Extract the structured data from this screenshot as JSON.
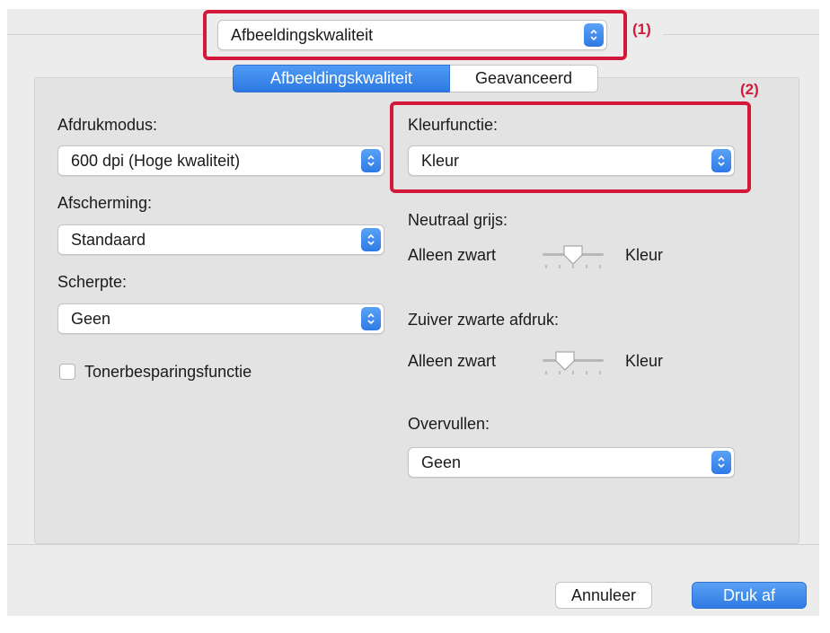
{
  "popup": {
    "value": "Afbeeldingskwaliteit",
    "icon": "chevron-updown-icon"
  },
  "tabs": [
    {
      "label": "Afbeeldingskwaliteit",
      "selected": true
    },
    {
      "label": "Geavanceerd",
      "selected": false
    }
  ],
  "left": {
    "print_mode": {
      "label": "Afdrukmodus:",
      "value": "600 dpi (Hoge kwaliteit)"
    },
    "screening": {
      "label": "Afscherming:",
      "value": "Standaard"
    },
    "sharpness": {
      "label": "Scherpte:",
      "value": "Geen"
    },
    "toner_save": {
      "label": "Tonerbesparingsfunctie",
      "checked": false
    }
  },
  "right": {
    "color_mode": {
      "label": "Kleurfunctie:",
      "value": "Kleur"
    },
    "neutral_gray": {
      "label": "Neutraal grijs:",
      "min_label": "Alleen zwart",
      "max_label": "Kleur",
      "level": 0.5
    },
    "pure_black": {
      "label": "Zuiver zwarte afdruk:",
      "min_label": "Alleen zwart",
      "max_label": "Kleur",
      "level": 0.35
    },
    "trapping": {
      "label": "Overvullen:",
      "value": "Geen"
    }
  },
  "callouts": {
    "one": "(1)",
    "two": "(2)"
  },
  "buttons": {
    "cancel": "Annuleer",
    "print": "Druk af"
  },
  "colors": {
    "accent": "#2f7ae5",
    "callout": "#d3183a"
  }
}
